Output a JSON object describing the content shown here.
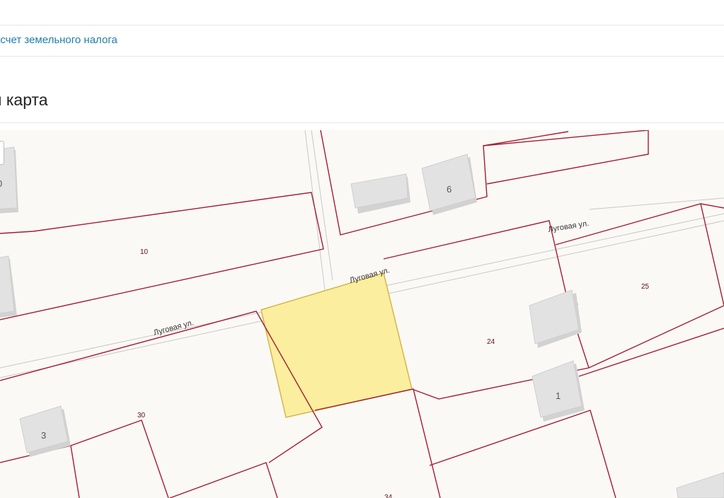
{
  "header": {
    "tax_link": "асчет земельного налога",
    "section_title": "я карта"
  },
  "map": {
    "street_name": "Луговая ул.",
    "parcel_numbers": [
      "10",
      "25",
      "24",
      "30",
      "34"
    ],
    "building_numbers": [
      "6",
      "1",
      "3",
      "0"
    ],
    "colors": {
      "parcel_border": "#a51c30",
      "selected_parcel_fill": "#fbee9e",
      "selected_parcel_border": "#d4b64a",
      "building": "#e2e2e2",
      "background": "#fbf9f6"
    }
  }
}
